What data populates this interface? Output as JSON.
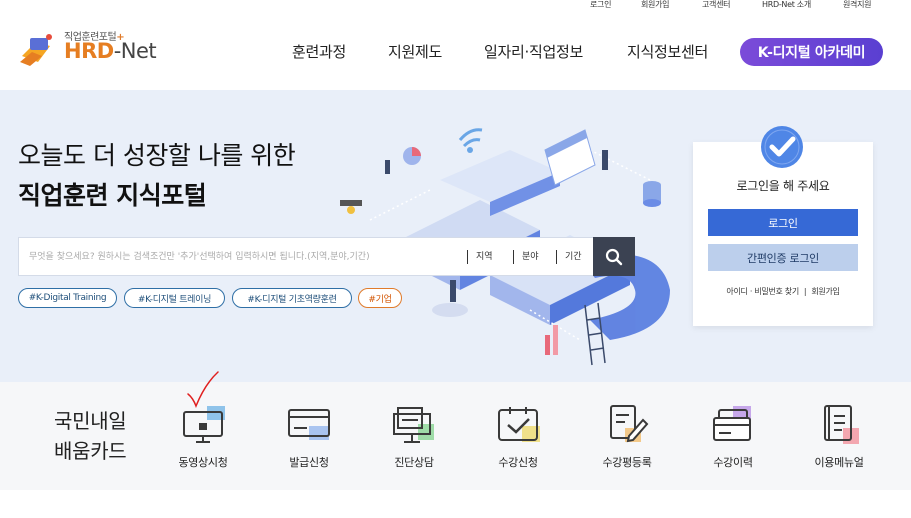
{
  "topbar": {
    "links": [
      "로그인",
      "회원가입",
      "고객센터",
      "HRD-Net 소개",
      "원격지원"
    ]
  },
  "logo": {
    "sub": "직업훈련포털",
    "main_hrd": "HRD",
    "main_net": "-Net"
  },
  "nav": {
    "items": [
      "훈련과정",
      "지원제도",
      "일자리·직업정보",
      "지식정보센터"
    ],
    "highlight": "K-디지털 아카데미"
  },
  "hero": {
    "headline1": "오늘도 더 성장할 나를 위한",
    "headline2": "직업훈련 지식포털",
    "search_placeholder": "무엇을 찾으세요? 원하시는 검색조건만 '추가'선택하여 입력하시면 됩니다.(지역,분야,기간)",
    "filters": [
      "지역",
      "분야",
      "기간"
    ],
    "tags": [
      "#K-Digital Training",
      "#K-디지털 트레이닝",
      "#K-디지털 기초역량훈련",
      "#기업"
    ]
  },
  "login": {
    "title": "로그인을 해 주세요",
    "login_button": "로그인",
    "cert_button": "간편인증 로그인",
    "find_link": "아이디 · 비밀번호 찾기",
    "join_link": "회원가입"
  },
  "card_section": {
    "title_line1": "국민내일",
    "title_line2": "배움카드",
    "items": [
      {
        "label": "동영상시청",
        "icon": "monitor-play-icon"
      },
      {
        "label": "발급신청",
        "icon": "card-icon"
      },
      {
        "label": "진단상담",
        "icon": "presentation-icon"
      },
      {
        "label": "수강신청",
        "icon": "checkbox-icon"
      },
      {
        "label": "수강평등록",
        "icon": "edit-document-icon"
      },
      {
        "label": "수강이력",
        "icon": "history-card-icon"
      },
      {
        "label": "이용메뉴얼",
        "icon": "manual-icon"
      }
    ]
  },
  "colors": {
    "brand_orange": "#e67e22",
    "login_blue": "#3669d6",
    "cert_blue": "#bccfec",
    "purple": "#6b45d6",
    "hero_bg": "#e9eff9"
  }
}
